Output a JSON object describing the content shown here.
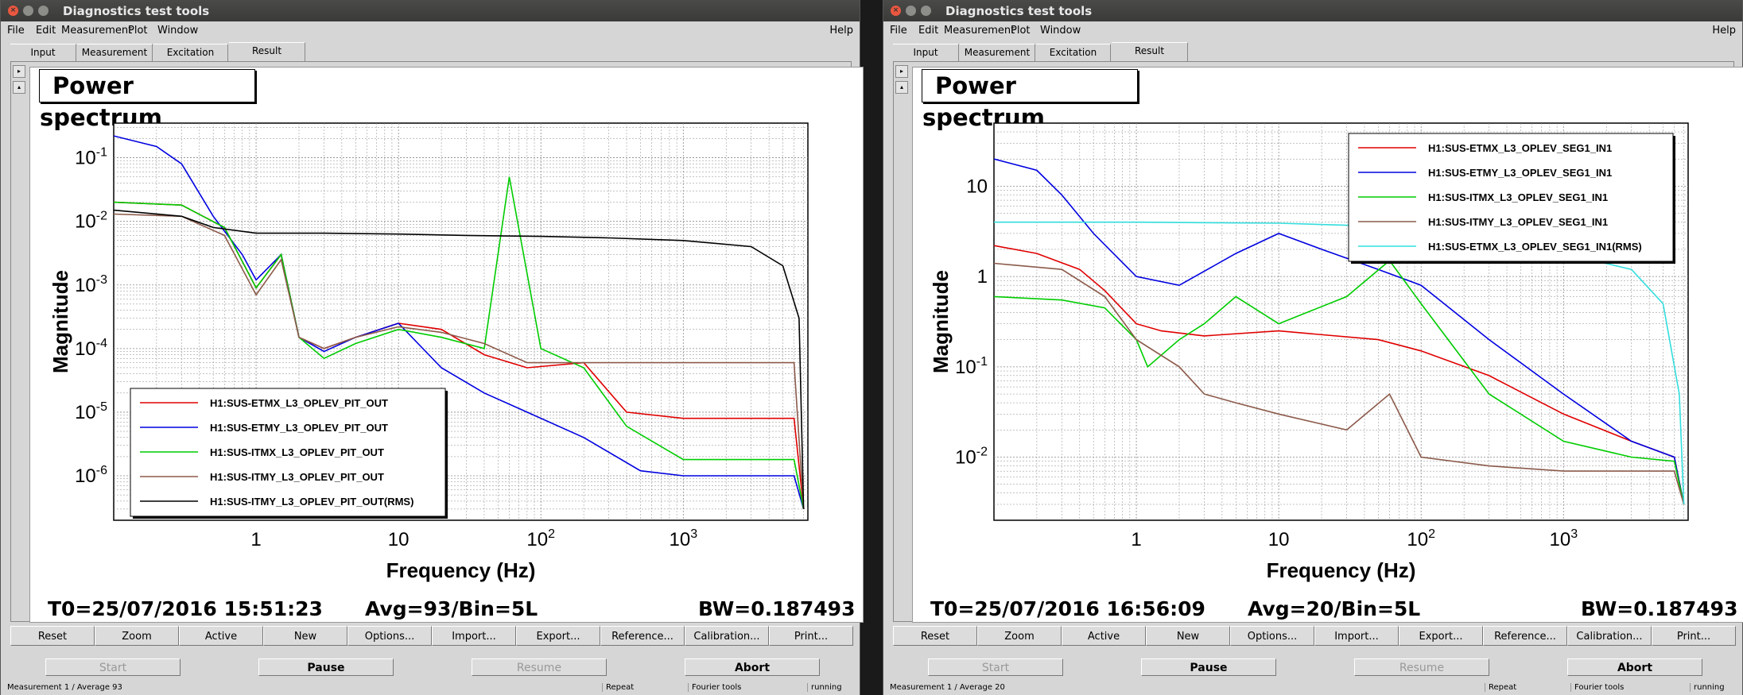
{
  "windows": [
    {
      "title": "Diagnostics test tools",
      "menus": [
        "File",
        "Edit",
        "Measurement",
        "Plot",
        "Window"
      ],
      "help": "Help",
      "tabs": [
        "Input",
        "Measurement",
        "Excitation",
        "Result"
      ],
      "active_tab": "Result",
      "plot_title": "Power spectrum",
      "footer": {
        "t0": "T0=25/07/2016 15:51:23",
        "avg": "Avg=93/Bin=5L",
        "bw": "BW=0.187493"
      },
      "buttons": [
        "Reset",
        "Zoom",
        "Active",
        "New",
        "Options...",
        "Import...",
        "Export...",
        "Reference...",
        "Calibration...",
        "Print..."
      ],
      "controls": [
        "Start",
        "Pause",
        "Resume",
        "Abort"
      ],
      "status": {
        "measurement": "Measurement 1 / Average 93",
        "repeat": "Repeat",
        "tool": "Fourier tools",
        "state": "running"
      }
    },
    {
      "title": "Diagnostics test tools",
      "menus": [
        "File",
        "Edit",
        "Measurement",
        "Plot",
        "Window"
      ],
      "help": "Help",
      "tabs": [
        "Input",
        "Measurement",
        "Excitation",
        "Result"
      ],
      "active_tab": "Result",
      "plot_title": "Power spectrum",
      "footer": {
        "t0": "T0=25/07/2016 16:56:09",
        "avg": "Avg=20/Bin=5L",
        "bw": "BW=0.187493"
      },
      "buttons": [
        "Reset",
        "Zoom",
        "Active",
        "New",
        "Options...",
        "Import...",
        "Export...",
        "Reference...",
        "Calibration...",
        "Print..."
      ],
      "controls": [
        "Start",
        "Pause",
        "Resume",
        "Abort"
      ],
      "status": {
        "measurement": "Measurement 1 / Average 20",
        "repeat": "Repeat",
        "tool": "Fourier tools",
        "state": "running"
      }
    }
  ],
  "colors": {
    "red": "#e00000",
    "blue": "#0000e0",
    "green": "#00cc00",
    "brown": "#8b5a4a",
    "black": "#000000",
    "cyan": "#33dddd"
  },
  "chart_data": [
    {
      "type": "line",
      "title": "Power spectrum",
      "xlabel": "Frequency (Hz)",
      "ylabel": "Magnitude",
      "xscale": "log",
      "yscale": "log",
      "xlim": [
        0.1,
        7500
      ],
      "ylim": [
        2e-07,
        0.35
      ],
      "x_ticks": [
        "1",
        "10",
        "10^2",
        "10^3"
      ],
      "y_ticks": [
        "10^-6",
        "10^-5",
        "10^-4",
        "10^-3",
        "10^-2",
        "10^-1"
      ],
      "grid": true,
      "legend_position": "bottom-left",
      "series": [
        {
          "name": "H1:SUS-ETMX_L3_OPLEV_PIT_OUT",
          "color": "red",
          "x": [
            0.1,
            0.3,
            0.6,
            1.0,
            1.5,
            2.0,
            3.0,
            5.0,
            10,
            20,
            40,
            80,
            200,
            400,
            1000,
            3000,
            6000,
            7000
          ],
          "y": [
            0.02,
            0.018,
            0.008,
            0.0009,
            0.003,
            0.00015,
            0.0001,
            0.00015,
            0.00025,
            0.0002,
            8e-05,
            5e-05,
            6e-05,
            1e-05,
            8e-06,
            8e-06,
            8e-06,
            3e-07
          ]
        },
        {
          "name": "H1:SUS-ETMY_L3_OPLEV_PIT_OUT",
          "color": "blue",
          "x": [
            0.1,
            0.2,
            0.3,
            0.5,
            0.8,
            1.0,
            1.5,
            2.0,
            3.0,
            5.0,
            10,
            20,
            40,
            80,
            200,
            500,
            1000,
            3000,
            6000,
            7000
          ],
          "y": [
            0.22,
            0.15,
            0.08,
            0.012,
            0.003,
            0.0012,
            0.003,
            0.00015,
            9e-05,
            0.00015,
            0.00025,
            5e-05,
            2e-05,
            1e-05,
            4e-06,
            1.2e-06,
            1e-06,
            1e-06,
            1e-06,
            3e-07
          ]
        },
        {
          "name": "H1:SUS-ITMX_L3_OPLEV_PIT_OUT",
          "color": "green",
          "x": [
            0.1,
            0.3,
            0.6,
            1.0,
            1.5,
            2.0,
            3.0,
            5.0,
            10,
            20,
            40,
            60,
            100,
            200,
            400,
            1000,
            3000,
            6000,
            7000
          ],
          "y": [
            0.02,
            0.018,
            0.008,
            0.0009,
            0.003,
            0.00015,
            7e-05,
            0.00012,
            0.0002,
            0.00015,
            0.0001,
            0.05,
            0.0001,
            5e-05,
            6e-06,
            1.8e-06,
            1.8e-06,
            1.8e-06,
            3e-07
          ]
        },
        {
          "name": "H1:SUS-ITMY_L3_OPLEV_PIT_OUT",
          "color": "brown",
          "x": [
            0.1,
            0.3,
            0.6,
            1.0,
            1.5,
            2.0,
            3.0,
            5.0,
            10,
            20,
            40,
            80,
            200,
            400,
            1000,
            3000,
            6000,
            7000
          ],
          "y": [
            0.013,
            0.012,
            0.006,
            0.0007,
            0.0025,
            0.00015,
            0.0001,
            0.00015,
            0.00022,
            0.00018,
            0.00012,
            6e-05,
            6e-05,
            6e-05,
            6e-05,
            6e-05,
            6e-05,
            3e-07
          ]
        },
        {
          "name": "H1:SUS-ITMY_L3_OPLEV_PIT_OUT(RMS)",
          "color": "black",
          "x": [
            0.1,
            0.3,
            0.5,
            1.0,
            3.0,
            10,
            30,
            100,
            300,
            1000,
            3000,
            5000,
            6500,
            7000
          ],
          "y": [
            0.015,
            0.012,
            0.008,
            0.0065,
            0.0065,
            0.0063,
            0.006,
            0.0058,
            0.0055,
            0.005,
            0.004,
            0.002,
            0.0003,
            3e-07
          ]
        }
      ]
    },
    {
      "type": "line",
      "title": "Power spectrum",
      "xlabel": "Frequency (Hz)",
      "ylabel": "Magnitude",
      "xscale": "log",
      "yscale": "log",
      "xlim": [
        0.1,
        7500
      ],
      "ylim": [
        0.002,
        50
      ],
      "x_ticks": [
        "1",
        "10",
        "10^2",
        "10^3"
      ],
      "y_ticks": [
        "10^-2",
        "10^-1",
        "1",
        "10"
      ],
      "grid": true,
      "legend_position": "top-right",
      "series": [
        {
          "name": "H1:SUS-ETMX_L3_OPLEV_SEG1_IN1",
          "color": "red",
          "x": [
            0.1,
            0.2,
            0.4,
            0.6,
            1.0,
            1.5,
            3.0,
            10,
            50,
            100,
            300,
            1000,
            3000,
            6000,
            7000
          ],
          "y": [
            2.2,
            1.8,
            1.2,
            0.7,
            0.3,
            0.25,
            0.22,
            0.25,
            0.2,
            0.15,
            0.08,
            0.03,
            0.015,
            0.01,
            0.003
          ]
        },
        {
          "name": "H1:SUS-ETMY_L3_OPLEV_SEG1_IN1",
          "color": "blue",
          "x": [
            0.1,
            0.2,
            0.3,
            0.5,
            1.0,
            2.0,
            5.0,
            10,
            20,
            50,
            100,
            300,
            1000,
            3000,
            6000,
            7000
          ],
          "y": [
            20,
            15,
            8,
            3,
            1.0,
            0.8,
            1.8,
            3.0,
            2.0,
            1.2,
            0.8,
            0.2,
            0.05,
            0.015,
            0.01,
            0.003
          ]
        },
        {
          "name": "H1:SUS-ITMX_L3_OPLEV_SEG1_IN1",
          "color": "green",
          "x": [
            0.1,
            0.3,
            0.6,
            1.0,
            1.2,
            2.0,
            3.0,
            5.0,
            10,
            30,
            60,
            100,
            300,
            1000,
            3000,
            6000,
            7000
          ],
          "y": [
            0.6,
            0.55,
            0.45,
            0.2,
            0.1,
            0.2,
            0.3,
            0.6,
            0.3,
            0.6,
            1.5,
            0.5,
            0.05,
            0.015,
            0.01,
            0.009,
            0.003
          ]
        },
        {
          "name": "H1:SUS-ITMY_L3_OPLEV_SEG1_IN1",
          "color": "brown",
          "x": [
            0.1,
            0.3,
            0.6,
            1.0,
            2.0,
            3.0,
            5.0,
            10,
            30,
            60,
            100,
            300,
            1000,
            3000,
            6000,
            7000
          ],
          "y": [
            1.4,
            1.2,
            0.6,
            0.2,
            0.1,
            0.05,
            0.04,
            0.03,
            0.02,
            0.05,
            0.01,
            0.008,
            0.007,
            0.007,
            0.007,
            0.003
          ]
        },
        {
          "name": "H1:SUS-ETMX_L3_OPLEV_SEG1_IN1(RMS)",
          "color": "cyan",
          "x": [
            0.1,
            1.0,
            10,
            100,
            300,
            1000,
            3000,
            5000,
            6500,
            7000
          ],
          "y": [
            4.0,
            4.0,
            3.9,
            3.5,
            2.5,
            1.8,
            1.2,
            0.5,
            0.05,
            0.003
          ]
        }
      ]
    }
  ]
}
